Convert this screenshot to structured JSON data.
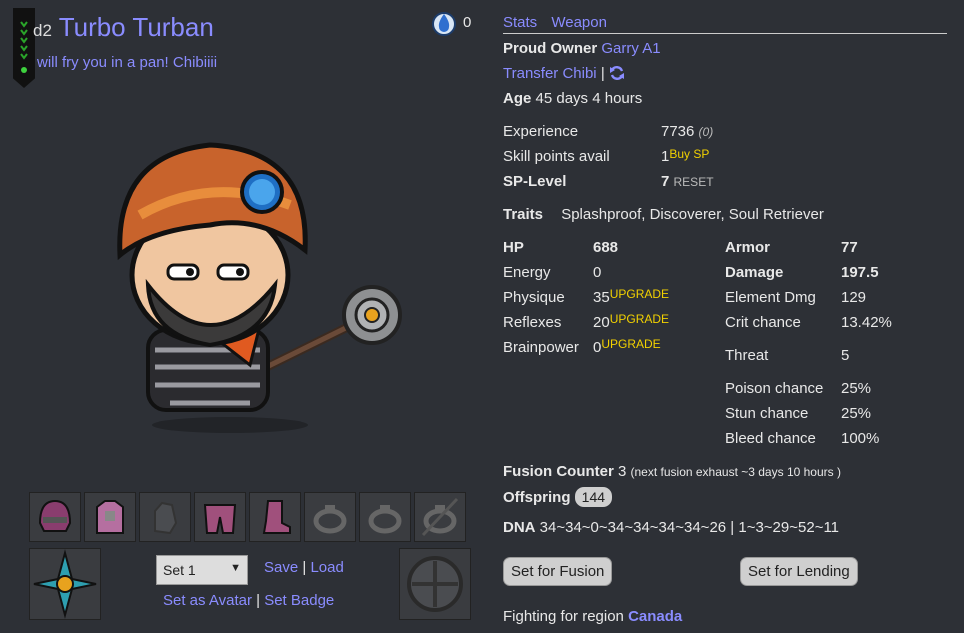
{
  "header": {
    "level_prefix": "d2",
    "name": "Turbo Turban",
    "motto": "will fry you in a pan! Chibiiii",
    "gem_count": "0"
  },
  "tabs": [
    "Stats",
    "Weapon"
  ],
  "owner": {
    "label": "Proud Owner",
    "name": "Garry A1"
  },
  "transfer_label": "Transfer Chibi",
  "age": {
    "label": "Age",
    "value": "45 days 4 hours"
  },
  "experience": {
    "label": "Experience",
    "value": "7736",
    "extra": "(0)"
  },
  "skill_points": {
    "label": "Skill points avail",
    "value": "1",
    "action": "Buy SP"
  },
  "sp_level": {
    "label": "SP-Level",
    "value": "7",
    "action": "RESET"
  },
  "traits": {
    "label": "Traits",
    "value": "Splashproof, Discoverer, Soul Retriever"
  },
  "stats_left": [
    {
      "label": "HP",
      "value": "688",
      "bold": true
    },
    {
      "label": "Energy",
      "value": "0"
    },
    {
      "label": "Physique",
      "value": "35",
      "upgrade": "UPGRADE"
    },
    {
      "label": "Reflexes",
      "value": "20",
      "upgrade": "UPGRADE"
    },
    {
      "label": "Brainpower",
      "value": "0",
      "upgrade": "UPGRADE"
    }
  ],
  "stats_right": [
    {
      "label": "Armor",
      "value": "77",
      "bold": true
    },
    {
      "label": "Damage",
      "value": "197.5",
      "bold": true
    },
    {
      "label": "Element Dmg",
      "value": "129"
    },
    {
      "label": "Crit chance",
      "value": "13.42%"
    },
    {
      "label": "Threat",
      "value": "5"
    },
    {
      "label": "Poison chance",
      "value": "25%"
    },
    {
      "label": "Stun chance",
      "value": "25%"
    },
    {
      "label": "Bleed chance",
      "value": "100%"
    }
  ],
  "fusion": {
    "label": "Fusion Counter",
    "value": "3",
    "note": "(next fusion exhaust ~3 days 10 hours )"
  },
  "offspring": {
    "label": "Offspring",
    "value": "144"
  },
  "dna": {
    "label": "DNA",
    "value": "34~34~0~34~34~34~34~26 | 1~3~29~52~11"
  },
  "buttons": {
    "fusion": "Set for Fusion",
    "lending": "Set for Lending"
  },
  "region": {
    "label": "Fighting for region",
    "value": "Canada"
  },
  "equipment": {
    "set_select": "Set 1",
    "save": "Save",
    "load": "Load",
    "set_avatar": "Set as Avatar",
    "set_badge": "Set Badge"
  },
  "colors": {
    "background": "#2d3036",
    "link": "#8a8cff",
    "upgrade": "#f2d100"
  }
}
